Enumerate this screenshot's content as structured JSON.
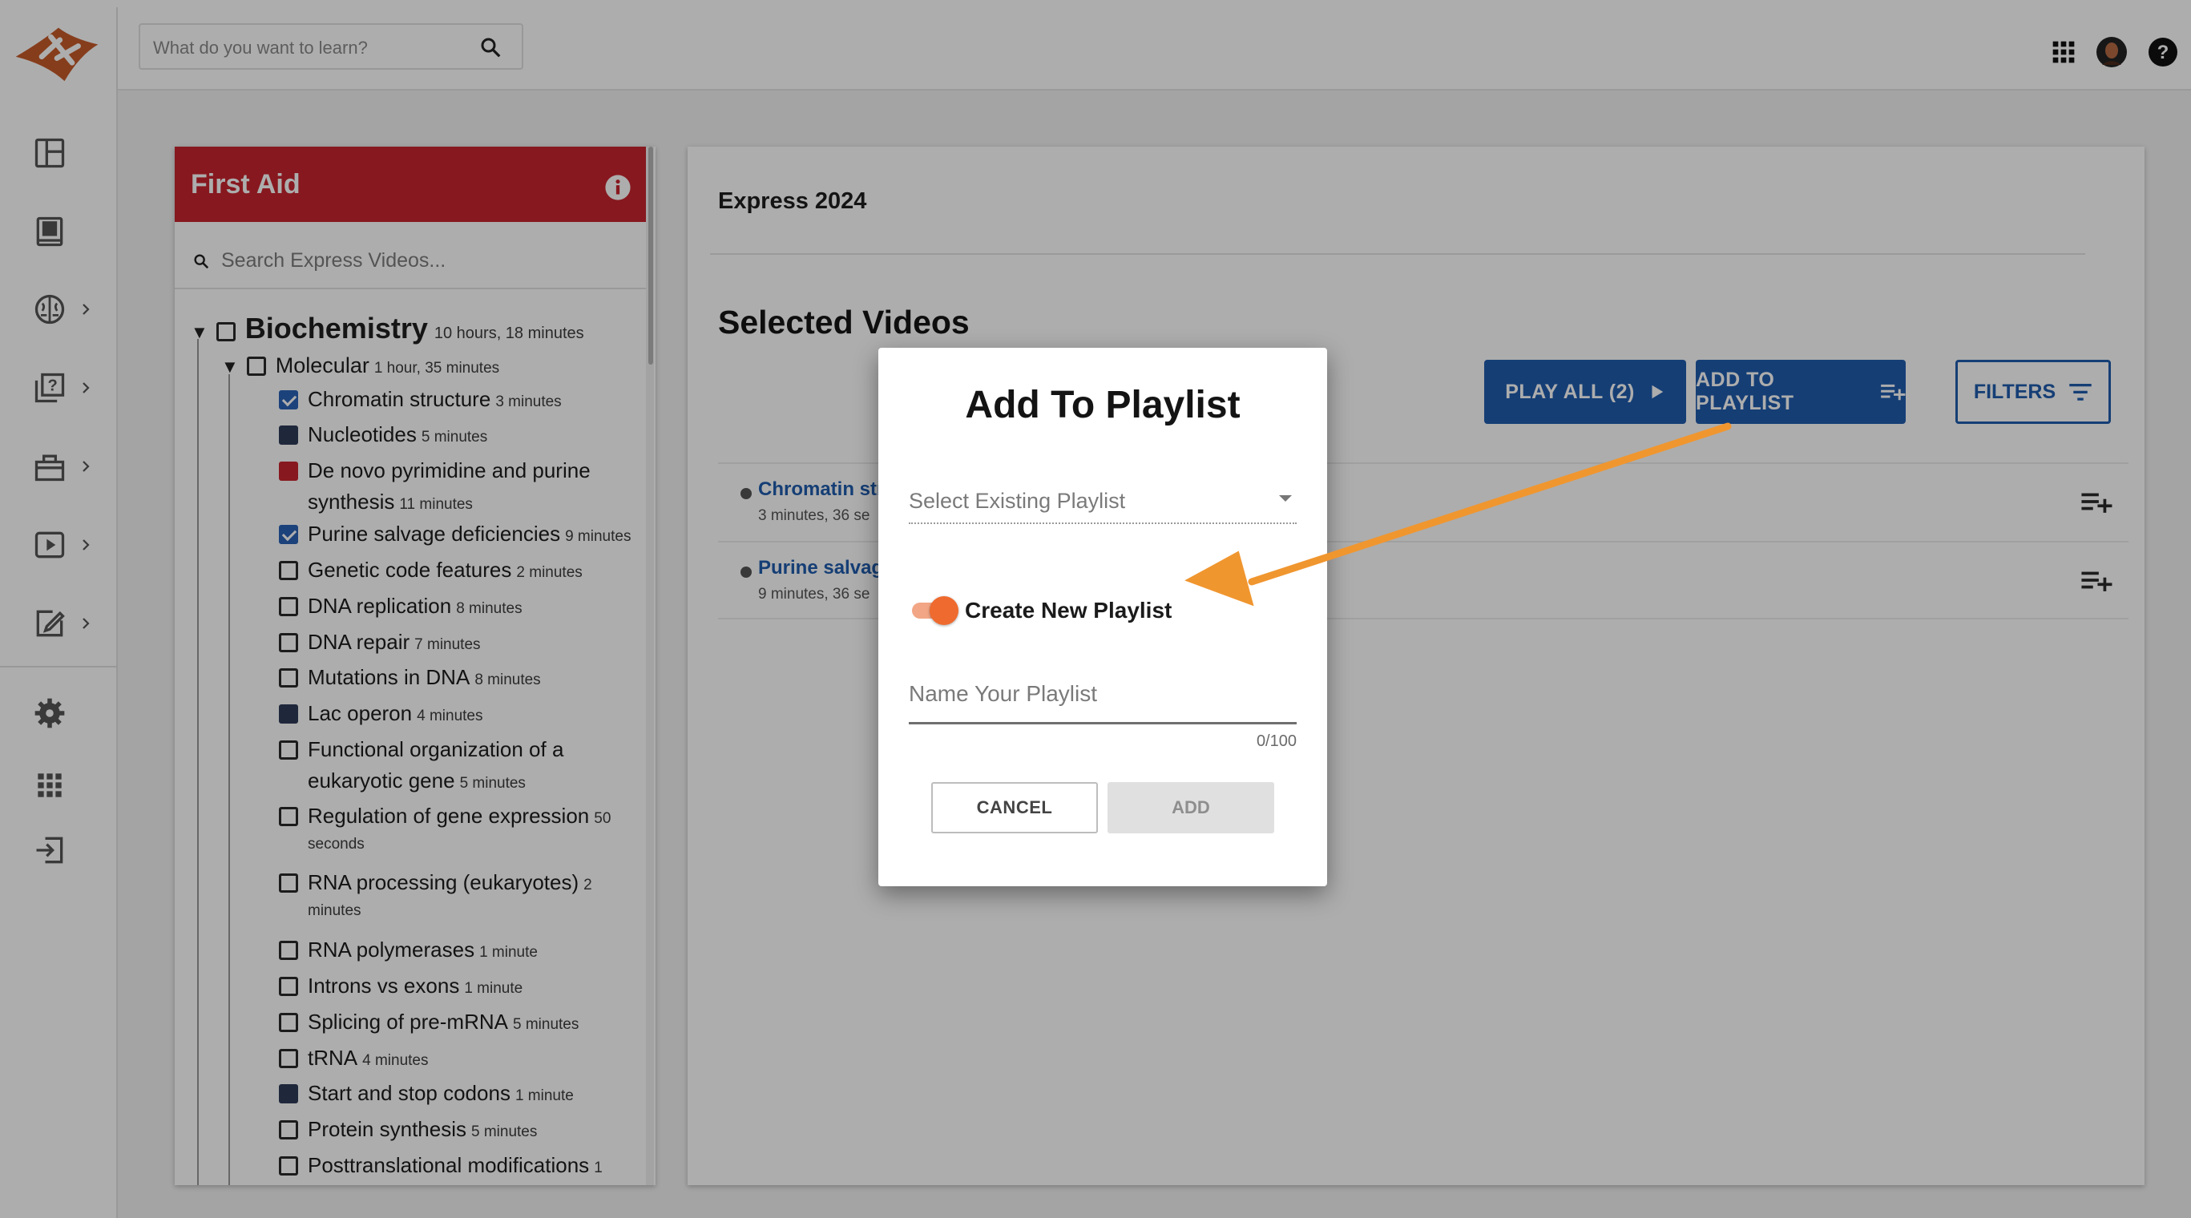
{
  "header": {
    "search_placeholder": "What do you want to learn?",
    "search_icon": "search-icon",
    "apps_icon": "apps-grid-icon",
    "avatar_icon": "user-avatar",
    "help_icon": "help-icon"
  },
  "rail": {
    "items": [
      {
        "icon": "dashboard-icon"
      },
      {
        "icon": "book-icon"
      },
      {
        "icon": "brain-icon"
      },
      {
        "icon": "question-bank-icon"
      },
      {
        "icon": "briefcase-icon"
      },
      {
        "icon": "video-icon"
      },
      {
        "icon": "notes-edit-icon"
      },
      {
        "icon": "settings-icon"
      },
      {
        "icon": "apps-grid-icon"
      },
      {
        "icon": "logout-icon"
      }
    ]
  },
  "left_panel": {
    "title": "First Aid",
    "search_placeholder": "Search Express Videos...",
    "tree": {
      "top": {
        "label": "Biochemistry",
        "duration": "10 hours, 18 minutes"
      },
      "sub": {
        "label": "Molecular",
        "duration": "1 hour, 35 minutes"
      },
      "items": [
        {
          "label": "Chromatin structure",
          "duration": "3 minutes",
          "state": "checked"
        },
        {
          "label": "Nucleotides",
          "duration": "5 minutes",
          "state": "filled"
        },
        {
          "label": "De novo pyrimidine and purine",
          "label2": "synthesis",
          "duration": "11 minutes",
          "state": "red"
        },
        {
          "label": "Purine salvage deficiencies",
          "duration": "9 minutes",
          "state": "checked"
        },
        {
          "label": "Genetic code features",
          "duration": "2 minutes",
          "state": "empty"
        },
        {
          "label": "DNA replication",
          "duration": "8 minutes",
          "state": "empty"
        },
        {
          "label": "DNA repair",
          "duration": "7 minutes",
          "state": "empty"
        },
        {
          "label": "Mutations in DNA",
          "duration": "8 minutes",
          "state": "empty"
        },
        {
          "label": "Lac operon",
          "duration": "4 minutes",
          "state": "filled"
        },
        {
          "label": "Functional organization of a",
          "label2": "eukaryotic gene",
          "duration": "5 minutes",
          "state": "empty"
        },
        {
          "label": "Regulation of gene expression",
          "duration": "50",
          "label2": "seconds",
          "state": "empty"
        },
        {
          "label": "RNA processing (eukaryotes)",
          "duration": "2",
          "label2": "minutes",
          "state": "empty"
        },
        {
          "label": "RNA polymerases",
          "duration": "1 minute",
          "state": "empty"
        },
        {
          "label": "Introns vs exons",
          "duration": "1 minute",
          "state": "empty"
        },
        {
          "label": "Splicing of pre-mRNA",
          "duration": "5 minutes",
          "state": "empty"
        },
        {
          "label": "tRNA",
          "duration": "4 minutes",
          "state": "empty"
        },
        {
          "label": "Start and stop codons",
          "duration": "1 minute",
          "state": "filled"
        },
        {
          "label": "Protein synthesis",
          "duration": "5 minutes",
          "state": "empty"
        },
        {
          "label": "Posttranslational modifications",
          "duration": "1",
          "state": "empty"
        }
      ]
    }
  },
  "right_panel": {
    "heading": "Express 2024",
    "section_title": "Selected Videos",
    "play_all": "PLAY ALL (2)",
    "add_to_playlist": "ADD TO PLAYLIST",
    "filters": "FILTERS",
    "videos": [
      {
        "title": "Chromatin str",
        "meta": "3 minutes, 36 se"
      },
      {
        "title": "Purine salvag",
        "meta": "9 minutes, 36 se"
      }
    ]
  },
  "modal": {
    "title": "Add To Playlist",
    "select_placeholder": "Select Existing Playlist",
    "toggle_label": "Create New Playlist",
    "toggle_on": true,
    "name_placeholder": "Name Your Playlist",
    "name_value": "",
    "counter": "0/100",
    "cancel": "CANCEL",
    "add": "ADD"
  },
  "colors": {
    "brand_red": "#c8242e",
    "primary_blue": "#1f5cad",
    "toggle_orange": "#ef6a2e",
    "annotation_arrow": "#f0962f"
  }
}
